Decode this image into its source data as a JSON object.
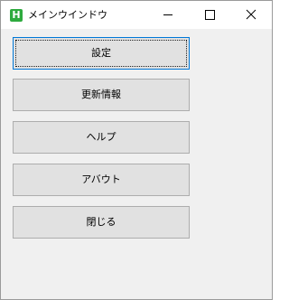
{
  "window": {
    "title": "メインウインドウ",
    "icon_label": "H",
    "icon_color": "#2eaa3e"
  },
  "titlebar_buttons": {
    "minimize_icon": "minimize-icon",
    "maximize_icon": "maximize-icon",
    "close_icon": "close-icon"
  },
  "menu": {
    "buttons": [
      {
        "label": "設定"
      },
      {
        "label": "更新情報"
      },
      {
        "label": "ヘルプ"
      },
      {
        "label": "アバウト"
      },
      {
        "label": "閉じる"
      }
    ]
  }
}
